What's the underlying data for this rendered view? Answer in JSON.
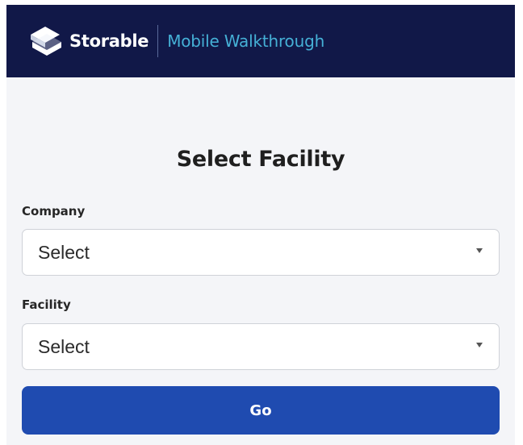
{
  "header": {
    "brand": "Storable",
    "subtitle": "Mobile Walkthrough",
    "background_color": "#111848",
    "subtitle_color": "#45b0d6",
    "logo_icon": "storable-logo-icon"
  },
  "main": {
    "title": "Select Facility",
    "company": {
      "label": "Company",
      "selected": "Select",
      "caret_icon": "caret-down-icon"
    },
    "facility": {
      "label": "Facility",
      "selected": "Select",
      "caret_icon": "caret-down-icon"
    },
    "go_button": {
      "label": "Go",
      "color": "#1f4bb0"
    }
  }
}
